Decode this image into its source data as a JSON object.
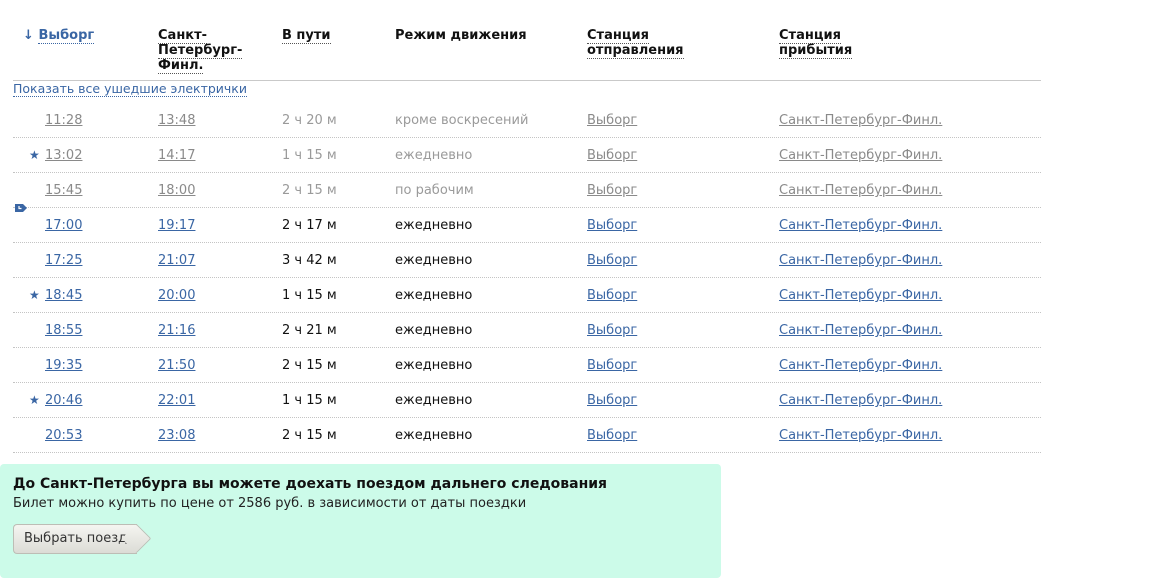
{
  "header": {
    "sort_arrow": "↓",
    "col_from": "Выборг",
    "col_to_lines": [
      "Санкт-",
      "Петербург-",
      "Финл."
    ],
    "col_duration": "В пути",
    "col_mode": "Режим движения",
    "col_dep_station_lines": [
      "Станция",
      "отправления"
    ],
    "col_arr_station_lines": [
      "Станция",
      "прибытия"
    ]
  },
  "show_all_link": "Показать все ушедшие электрички",
  "rows": [
    {
      "star": false,
      "past": true,
      "dep": "11:28",
      "arr": "13:48",
      "dur": "2 ч 20 м",
      "mode": "кроме воскресений",
      "from": "Выборг",
      "to": "Санкт-Петербург-Финл."
    },
    {
      "star": true,
      "past": true,
      "dep": "13:02",
      "arr": "14:17",
      "dur": "1 ч 15 м",
      "mode": "ежедневно",
      "from": "Выборг",
      "to": "Санкт-Петербург-Финл."
    },
    {
      "star": false,
      "past": true,
      "dep": "15:45",
      "arr": "18:00",
      "dur": "2 ч 15 м",
      "mode": "по рабочим",
      "from": "Выборг",
      "to": "Санкт-Петербург-Финл."
    },
    {
      "star": false,
      "past": false,
      "dep": "17:00",
      "arr": "19:17",
      "dur": "2 ч 17 м",
      "mode": "ежедневно",
      "from": "Выборг",
      "to": "Санкт-Петербург-Финл."
    },
    {
      "star": false,
      "past": false,
      "dep": "17:25",
      "arr": "21:07",
      "dur": "3 ч 42 м",
      "mode": "ежедневно",
      "from": "Выборг",
      "to": "Санкт-Петербург-Финл."
    },
    {
      "star": true,
      "past": false,
      "dep": "18:45",
      "arr": "20:00",
      "dur": "1 ч 15 м",
      "mode": "ежедневно",
      "from": "Выборг",
      "to": "Санкт-Петербург-Финл."
    },
    {
      "star": false,
      "past": false,
      "dep": "18:55",
      "arr": "21:16",
      "dur": "2 ч 21 м",
      "mode": "ежедневно",
      "from": "Выборг",
      "to": "Санкт-Петербург-Финл."
    },
    {
      "star": false,
      "past": false,
      "dep": "19:35",
      "arr": "21:50",
      "dur": "2 ч 15 м",
      "mode": "ежедневно",
      "from": "Выборг",
      "to": "Санкт-Петербург-Финл."
    },
    {
      "star": true,
      "past": false,
      "dep": "20:46",
      "arr": "22:01",
      "dur": "1 ч 15 м",
      "mode": "ежедневно",
      "from": "Выборг",
      "to": "Санкт-Петербург-Финл."
    },
    {
      "star": false,
      "past": false,
      "dep": "20:53",
      "arr": "23:08",
      "dur": "2 ч 15 м",
      "mode": "ежедневно",
      "from": "Выборг",
      "to": "Санкт-Петербург-Финл."
    }
  ],
  "star_glyph": "★",
  "promo": {
    "title": "До Санкт-Петербурга вы можете доехать поездом дальнего следования",
    "subtitle": "Билет можно купить по цене от 2586 руб. в зависимости от даты поездки",
    "button": "Выбрать поезд",
    "bg_color": "#ccfbe9"
  },
  "colors": {
    "link": "#3a66a4",
    "past_text": "#8a8a8a",
    "current_marker": "#3a66a4"
  }
}
